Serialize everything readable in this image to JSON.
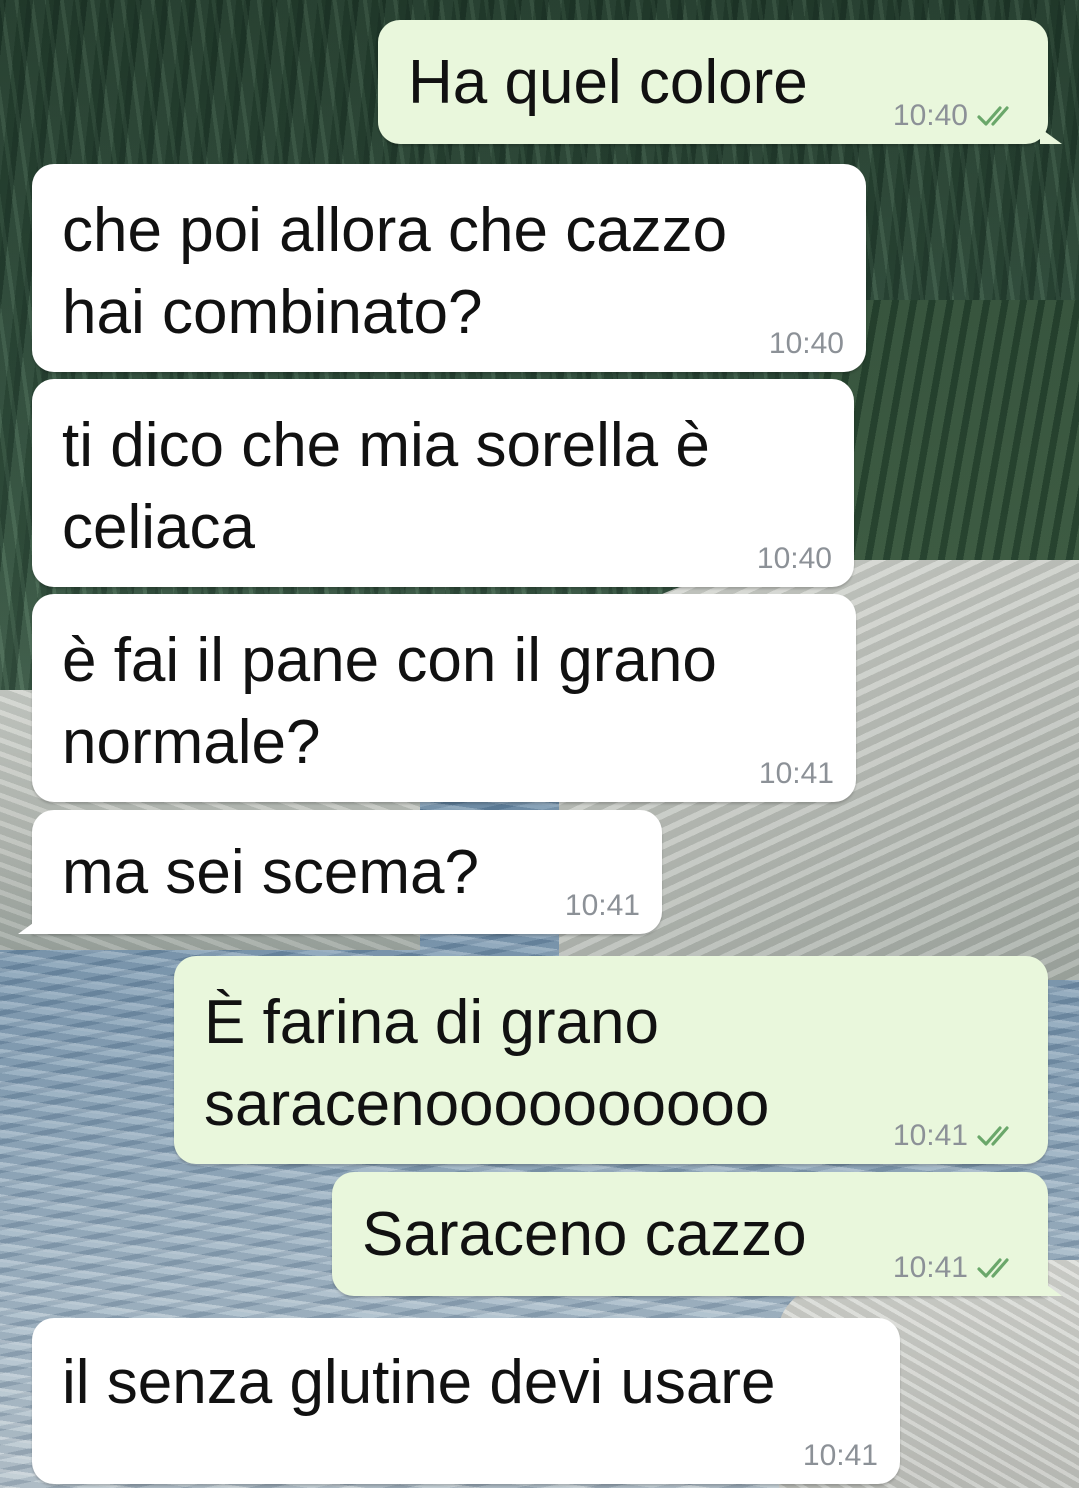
{
  "messages": [
    {
      "dir": "out",
      "text": "Ha quel colore",
      "time": "10:40",
      "status": "read"
    },
    {
      "dir": "in",
      "text": "che poi allora che cazzo\nhai combinato?",
      "time": "10:40"
    },
    {
      "dir": "in",
      "text": "ti dico che mia sorella è\nceliaca",
      "time": "10:40"
    },
    {
      "dir": "in",
      "text": "è fai il pane con il grano\nnormale?",
      "time": "10:41"
    },
    {
      "dir": "in",
      "text": "ma sei scema?",
      "time": "10:41"
    },
    {
      "dir": "out",
      "text": "È farina di grano\nsaracenoooooooooo",
      "time": "10:41",
      "status": "read"
    },
    {
      "dir": "out",
      "text": "Saraceno cazzo",
      "time": "10:41",
      "status": "read"
    },
    {
      "dir": "in",
      "text": "il senza glutine devi usare",
      "time": "10:41"
    }
  ],
  "colors": {
    "outgoing_bubble": "#e9f7dc",
    "incoming_bubble": "#ffffff",
    "time": "#8c9197",
    "read_ticks": "#6aa76a"
  },
  "icons": {
    "read_receipt": "double-check-icon"
  }
}
